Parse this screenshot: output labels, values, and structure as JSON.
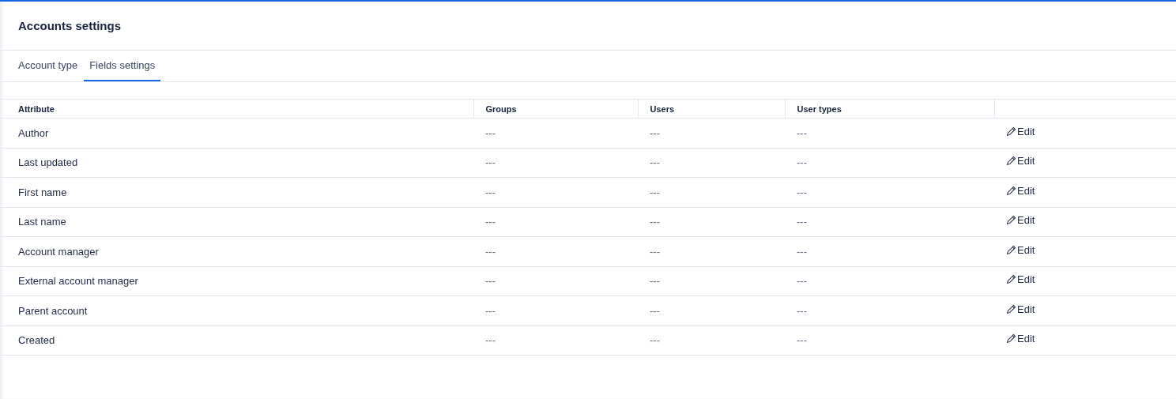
{
  "page": {
    "title": "Accounts settings"
  },
  "tabs": [
    {
      "label": "Account type",
      "selected": false
    },
    {
      "label": "Fields settings",
      "selected": true
    }
  ],
  "table": {
    "columns": [
      "Attribute",
      "Groups",
      "Users",
      "User types"
    ],
    "rows": [
      {
        "attribute": "Author",
        "groups": "---",
        "users": "---",
        "user_types": "---",
        "action": "Edit"
      },
      {
        "attribute": "Last updated",
        "groups": "---",
        "users": "---",
        "user_types": "---",
        "action": "Edit"
      },
      {
        "attribute": "First name",
        "groups": "---",
        "users": "---",
        "user_types": "---",
        "action": "Edit"
      },
      {
        "attribute": "Last name",
        "groups": "---",
        "users": "---",
        "user_types": "---",
        "action": "Edit"
      },
      {
        "attribute": "Account manager",
        "groups": "---",
        "users": "---",
        "user_types": "---",
        "action": "Edit"
      },
      {
        "attribute": "External account manager",
        "groups": "---",
        "users": "---",
        "user_types": "---",
        "action": "Edit"
      },
      {
        "attribute": "Parent account",
        "groups": "---",
        "users": "---",
        "user_types": "---",
        "action": "Edit"
      },
      {
        "attribute": "Created",
        "groups": "---",
        "users": "---",
        "user_types": "---",
        "action": "Edit"
      }
    ]
  }
}
